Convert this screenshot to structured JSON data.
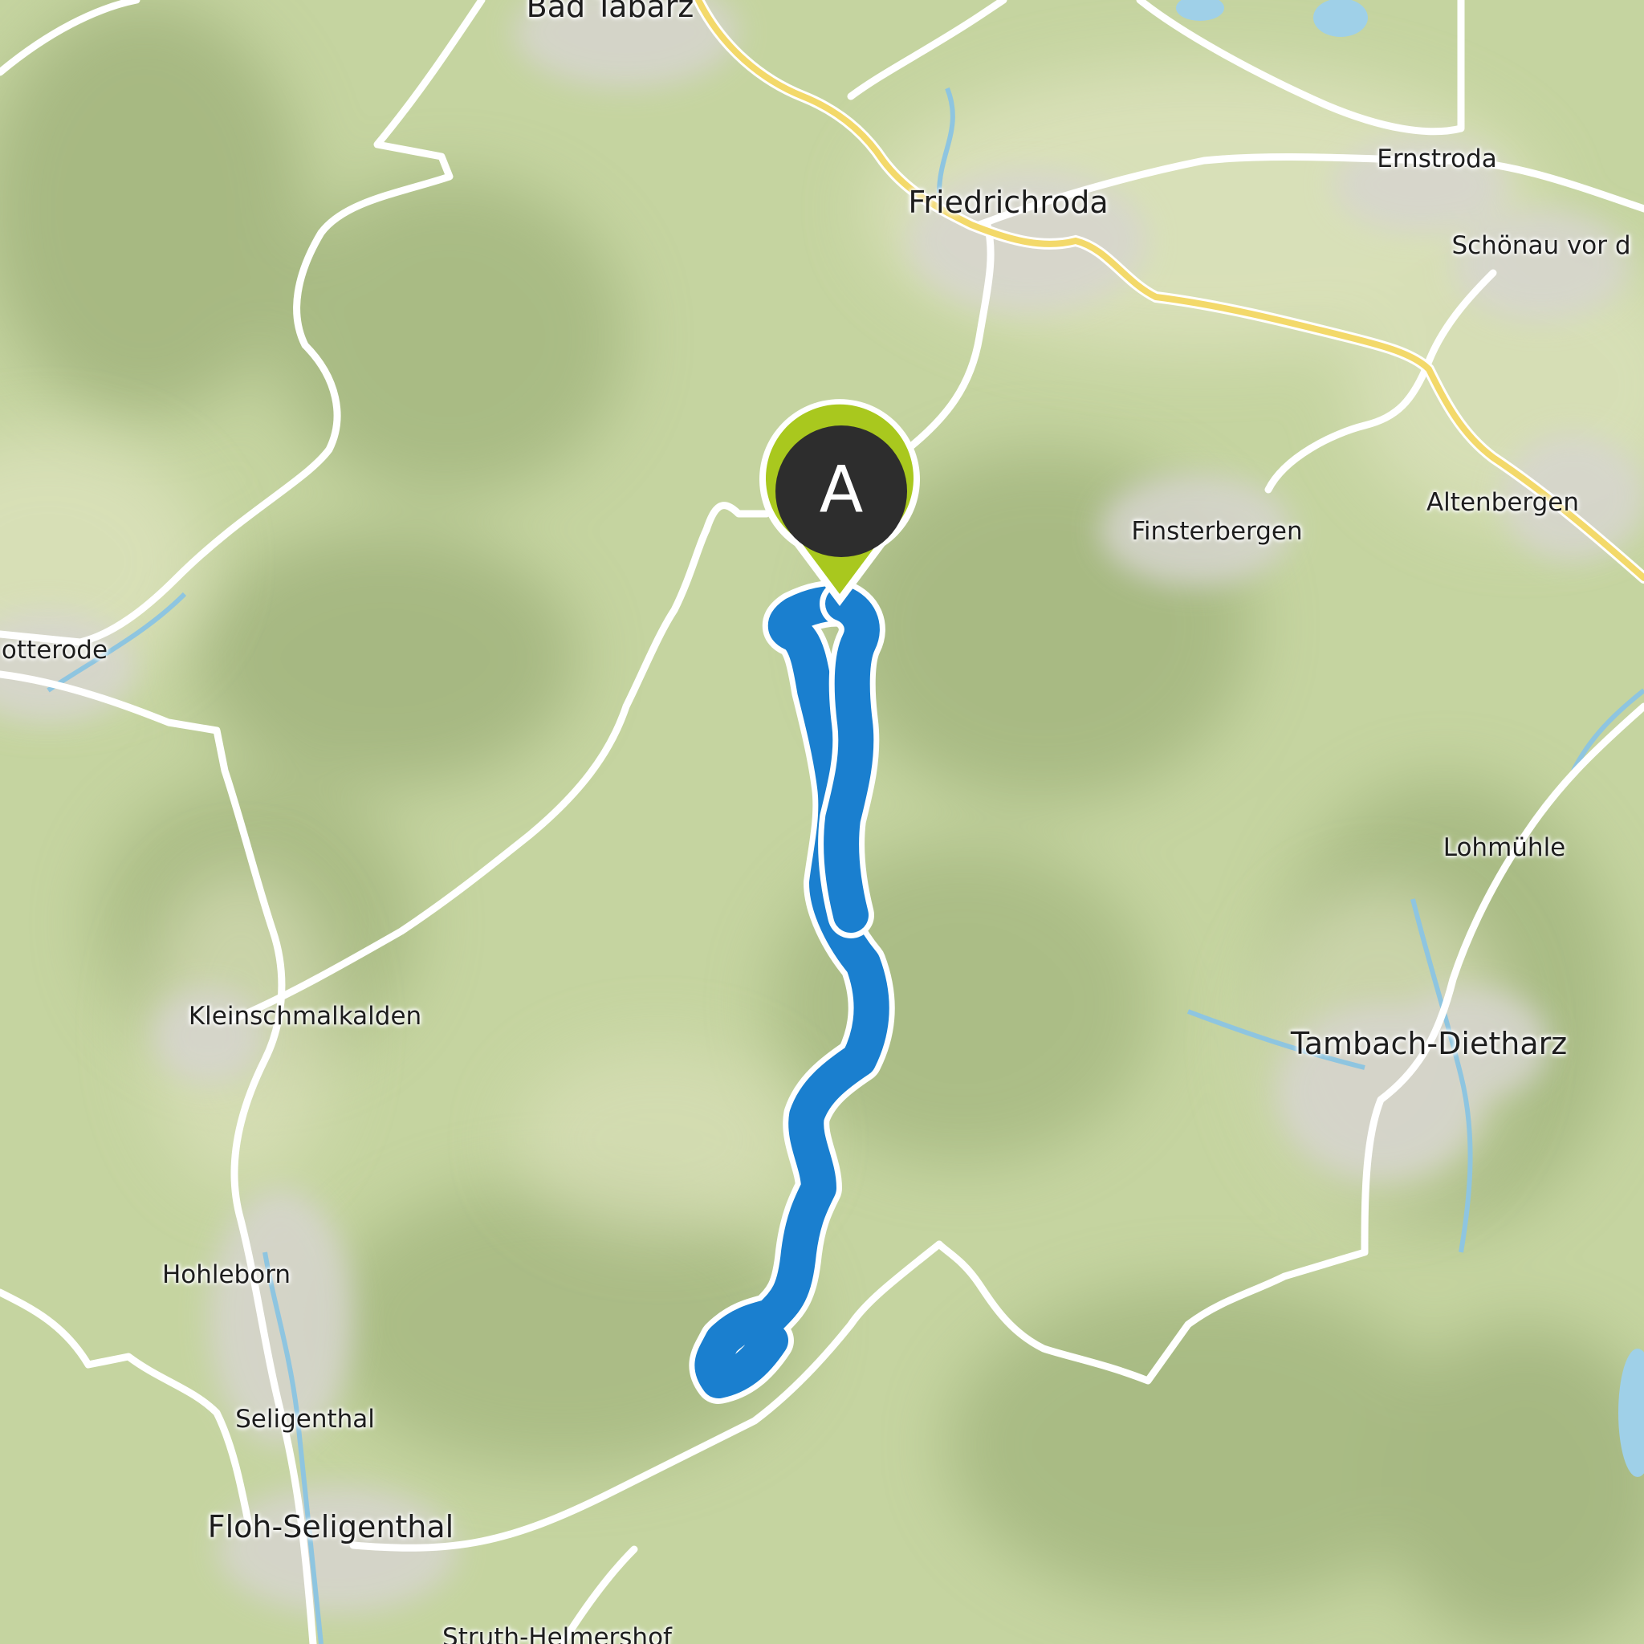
{
  "map": {
    "start_marker": {
      "letter": "A",
      "color": "#a9c81e",
      "inner_color": "#2d2d2d"
    },
    "route_color": "#1a7fcf",
    "places": [
      {
        "name": "Bad Tabarz"
      },
      {
        "name": "Friedrichroda"
      },
      {
        "name": "Ernstroda"
      },
      {
        "name": "Schönau vor d"
      },
      {
        "name": "Finsterbergen"
      },
      {
        "name": "Altenbergen"
      },
      {
        "name": "otterode"
      },
      {
        "name": "Lohmühle"
      },
      {
        "name": "Kleinschmalkalden"
      },
      {
        "name": "Tambach-Dietharz"
      },
      {
        "name": "Hohleborn"
      },
      {
        "name": "Seligenthal"
      },
      {
        "name": "Floh-Seligenthal"
      },
      {
        "name": "Struth-Helmershof"
      }
    ]
  }
}
